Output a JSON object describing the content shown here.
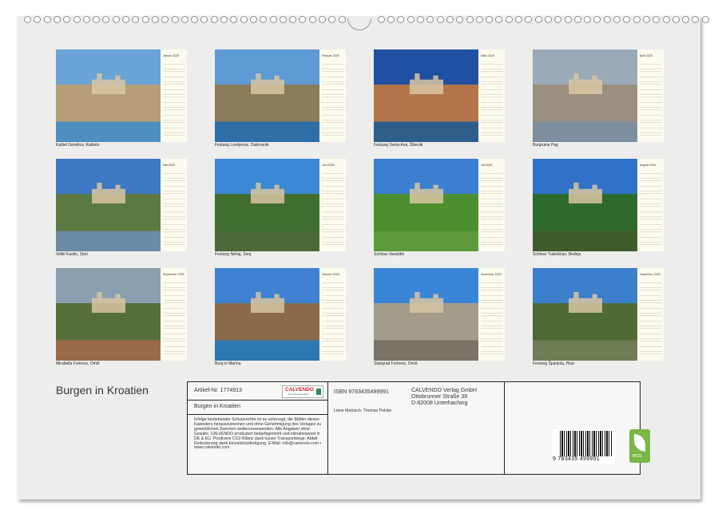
{
  "title": "Burgen in Kroatien",
  "months": [
    {
      "label": "Januar 2025",
      "caption": "Kaštel Gomilica, Kaštela",
      "sky": "#6aa3d6",
      "ground": "#b69e78",
      "water": "#4d8fbf"
    },
    {
      "label": "Februar 2025",
      "caption": "Festung Lovrijenac, Dubrovnik",
      "sky": "#5d9ad4",
      "ground": "#8a7b5a",
      "water": "#2f6fa8"
    },
    {
      "label": "März 2025",
      "caption": "Festung Sveta Ana, Šibenik",
      "sky": "#1f4fa0",
      "ground": "#b2764a",
      "water": "#2e5f8a"
    },
    {
      "label": "April 2025",
      "caption": "Burgruine Pag",
      "sky": "#9aaab8",
      "ground": "#9b8f80",
      "water": "#7d8f9e"
    },
    {
      "label": "Mai 2025",
      "caption": "Veliki Kastio, Ston",
      "sky": "#3f78c4",
      "ground": "#5b7a43",
      "water": "#6d8aa5"
    },
    {
      "label": "Juni 2025",
      "caption": "Festung Nehaj, Senj",
      "sky": "#3b88d6",
      "ground": "#3f6e2e",
      "water": "#4a6a3a"
    },
    {
      "label": "Juli 2025",
      "caption": "Schloss Varaždin",
      "sky": "#3b7fd0",
      "ground": "#4d8f2e",
      "water": "#5c9a3a"
    },
    {
      "label": "August 2025",
      "caption": "Schloss Trakošćan, Bednja",
      "sky": "#2f72c8",
      "ground": "#2e6a2c",
      "water": "#3e5c2c"
    },
    {
      "label": "September 2025",
      "caption": "Mirabella Fortress, Omiš",
      "sky": "#8aa0b0",
      "ground": "#566f3a",
      "water": "#9a6a48"
    },
    {
      "label": "Oktober 2025",
      "caption": "Burg in Marina",
      "sky": "#3f82d2",
      "ground": "#8a6a4a",
      "water": "#2d78b0"
    },
    {
      "label": "November 2025",
      "caption": "Starigrad Fortress, Omiš",
      "sky": "#3a85d8",
      "ground": "#a39c8a",
      "water": "#7a7466"
    },
    {
      "label": "Dezember 2025",
      "caption": "Festung Španjola, Hvar",
      "sky": "#3a7ecc",
      "ground": "#4f6a35",
      "water": "#6e7c55"
    }
  ],
  "info": {
    "artikel": "Artikel-Nr. 1774913",
    "logo_text": "CALVENDO",
    "logo_sub": "Die Kalendermarke",
    "product_title": "Burgen in Kroatien",
    "legal": "Infolge bestehender Schutzrechte ist es untersagt, die Blätter dieses Kalenders herauszutrennen und ohne Genehmigung des Verlages zu gewerblichen Zwecken weiterzuverwenden. Alle Angaben ohne Gewähr. CALVENDO produziert bedarfsgerecht und klimabewusst in DE & EU. Positivere CO2-Bilanz dank kurzer Transportwege. Abfall-Reduzierung dank Einzelstückfertigung. E-Mail: info@calvendo.com • www.calvendo.com",
    "isbn": "ISBN 9783435499991",
    "authors": "Liane Matrisch, Thomas Polske",
    "publisher": "CALVENDO Verlag GmbH",
    "street": "Ottobrunner Straße 39",
    "city": "D-82008 Unterhaching",
    "barcode": "9 783435 499991",
    "eco": "eco"
  }
}
